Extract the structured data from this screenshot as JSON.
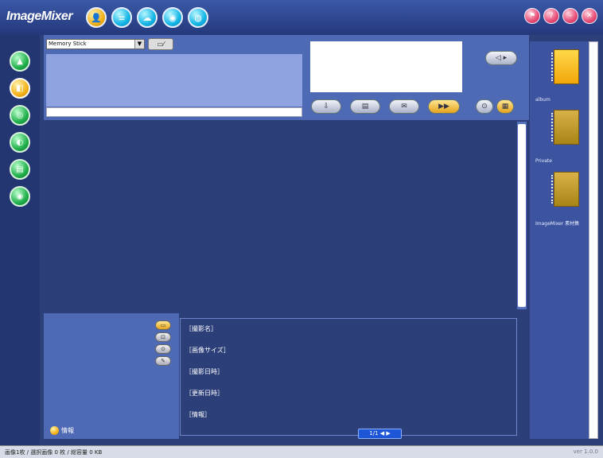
{
  "app": {
    "title": "ImageMixer"
  },
  "toolbar": {
    "mode_buttons": [
      {
        "icon": "person-icon",
        "label": "👤"
      },
      {
        "icon": "stack-icon",
        "label": "≡"
      },
      {
        "icon": "cloud-icon",
        "label": "☁"
      },
      {
        "icon": "disc-icon",
        "label": "◉"
      },
      {
        "icon": "globe-icon",
        "label": "◍"
      }
    ],
    "window_buttons": [
      {
        "icon": "user-icon",
        "label": "⚑"
      },
      {
        "icon": "help-icon",
        "label": "?"
      },
      {
        "icon": "minimize-icon",
        "label": "–"
      },
      {
        "icon": "close-icon",
        "label": "✕"
      }
    ]
  },
  "sidebar": {
    "items": [
      {
        "icon": "arrow-icon",
        "label": "▲"
      },
      {
        "icon": "album-icon",
        "label": "◧"
      },
      {
        "icon": "camera-icon",
        "label": "◎"
      },
      {
        "icon": "scanner-icon",
        "label": "◐"
      },
      {
        "icon": "print-icon",
        "label": "▤"
      },
      {
        "icon": "disc-icon",
        "label": "◉"
      }
    ]
  },
  "source": {
    "selected": "Memory Stick",
    "folder_button": "▭⁄"
  },
  "actions": [
    {
      "icon": "import-icon",
      "label": "⇩"
    },
    {
      "icon": "print-icon",
      "label": "▤"
    },
    {
      "icon": "mail-icon",
      "label": "✉"
    },
    {
      "icon": "slideshow-icon",
      "label": "▶▶"
    },
    {
      "icon": "settings-icon",
      "label": "⊙"
    },
    {
      "icon": "trash-icon",
      "label": "▦"
    }
  ],
  "nav_button": {
    "label": "◁ ▸"
  },
  "details": {
    "fields": [
      "［撮影名］",
      "［画像サイズ］",
      "［撮影日時］",
      "［更新日時］",
      "［情報］"
    ],
    "side_buttons": [
      "▭",
      "⊡",
      "⊙",
      "✎"
    ],
    "info_label": "情報",
    "pager": "1/1 ◀ ▶"
  },
  "albums": [
    {
      "label": "album"
    },
    {
      "label": "Private"
    },
    {
      "label": "ImageMixer 素材集"
    }
  ],
  "status": {
    "left": "画像1枚 / 選択画像 0 枚 / 総容量 0 KB",
    "right": "ver 1.0.0"
  }
}
